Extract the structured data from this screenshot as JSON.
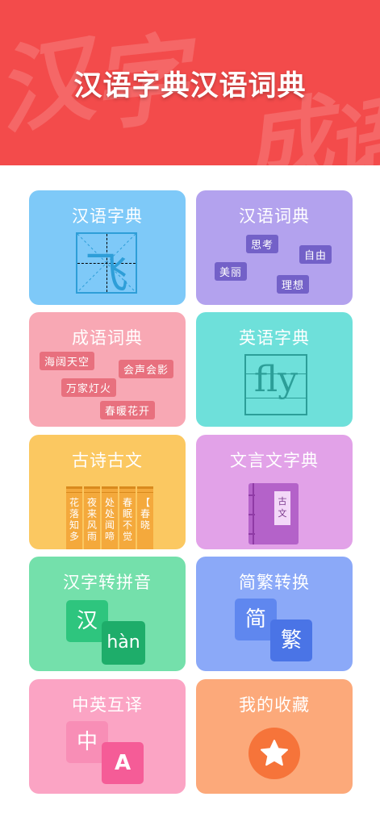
{
  "header": {
    "title": "汉语字典汉语词典",
    "background_color": "#f34b4b",
    "brush_chars": [
      "汉",
      "字",
      "成",
      "语"
    ]
  },
  "cards": [
    {
      "label": "汉语字典",
      "color": "#7ec9f8",
      "icon": "tianzige-grid-icon",
      "char": "飞"
    },
    {
      "label": "汉语词典",
      "color": "#b3a2ee",
      "tags": [
        "思考",
        "自由",
        "美丽",
        "理想"
      ]
    },
    {
      "label": "成语词典",
      "color": "#f8a8b4",
      "tags": [
        "海阔天空",
        "会声会影",
        "万家灯火",
        "春暖花开"
      ]
    },
    {
      "label": "英语字典",
      "color": "#6ee0da",
      "word": "fly"
    },
    {
      "label": "古诗古文",
      "color": "#fbc861",
      "books": [
        "花落知多",
        "夜来风雨",
        "处处闻啼",
        "春眠不觉",
        "【春晓"
      ]
    },
    {
      "label": "文言文字典",
      "color": "#e2a2e8",
      "book_label": "古文"
    },
    {
      "label": "汉字转拼音",
      "color": "#74e0ab",
      "hanzi": "汉",
      "pinyin": "hàn"
    },
    {
      "label": "简繁转换",
      "color": "#8ba9f8",
      "simplified": "简",
      "traditional": "繁"
    },
    {
      "label": "中英互译",
      "color": "#fba4c4",
      "chinese": "中",
      "english": "A"
    },
    {
      "label": "我的收藏",
      "color": "#fca97a",
      "icon": "star-icon"
    }
  ]
}
